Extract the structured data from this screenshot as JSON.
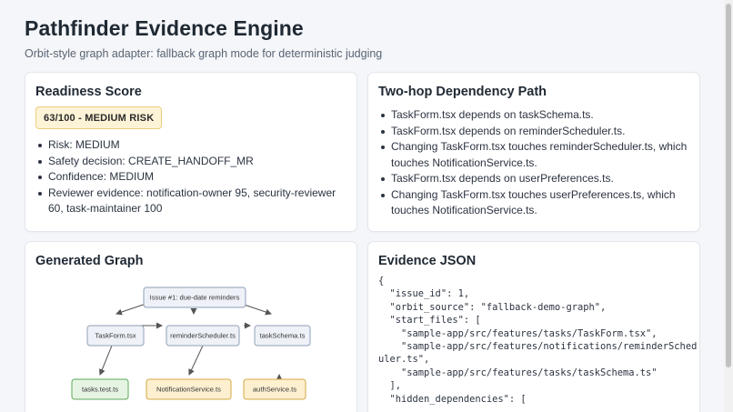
{
  "header": {
    "title": "Pathfinder Evidence Engine",
    "subtitle": "Orbit-style graph adapter: fallback graph mode for deterministic judging"
  },
  "readiness": {
    "title": "Readiness Score",
    "badge": "63/100 - MEDIUM RISK",
    "items": [
      "Risk: MEDIUM",
      "Safety decision: CREATE_HANDOFF_MR",
      "Confidence: MEDIUM",
      "Reviewer evidence: notification-owner 95, security-reviewer 60, task-maintainer 100"
    ]
  },
  "dependency": {
    "title": "Two-hop Dependency Path",
    "items": [
      "TaskForm.tsx depends on taskSchema.ts.",
      "TaskForm.tsx depends on reminderScheduler.ts.",
      "Changing TaskForm.tsx touches reminderScheduler.ts, which touches NotificationService.ts.",
      "TaskForm.tsx depends on userPreferences.ts.",
      "Changing TaskForm.tsx touches userPreferences.ts, which touches NotificationService.ts."
    ]
  },
  "graph": {
    "title": "Generated Graph",
    "nodes": {
      "issue": "Issue #1: due-date reminders",
      "taskform": "TaskForm.tsx",
      "reminder": "reminderScheduler.ts",
      "schema": "taskSchema.ts",
      "tasktest": "tasks.test.ts",
      "notification": "NotificationService.ts",
      "auth": "authService.ts"
    },
    "colors": {
      "neutral_fill": "#eef1f7",
      "neutral_stroke": "#8fa0b8",
      "test_fill": "#e6f4e4",
      "test_stroke": "#5daa5a",
      "service_fill": "#fdf0d0",
      "service_stroke": "#d4a843",
      "edge": "#555555"
    }
  },
  "evidence": {
    "title": "Evidence JSON",
    "json_text": "{\n  \"issue_id\": 1,\n  \"orbit_source\": \"fallback-demo-graph\",\n  \"start_files\": [\n    \"sample-app/src/features/tasks/TaskForm.tsx\",\n    \"sample-app/src/features/notifications/reminderScheduler.ts\",\n    \"sample-app/src/features/tasks/taskSchema.ts\"\n  ],\n  \"hidden_dependencies\": ["
  }
}
